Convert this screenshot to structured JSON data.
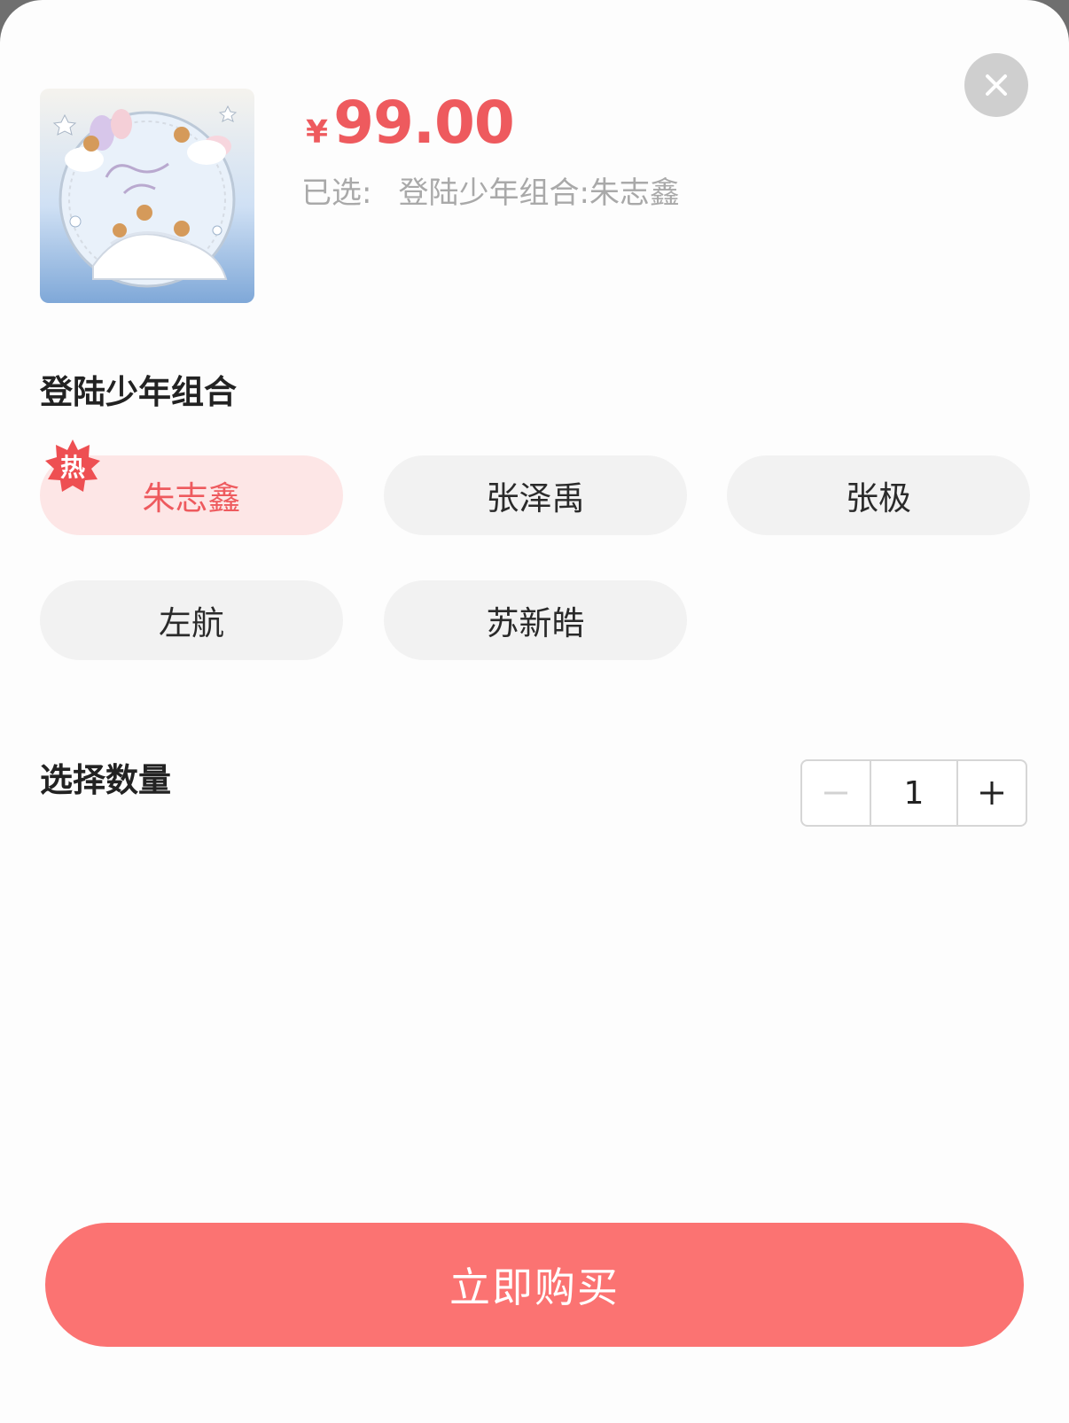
{
  "product": {
    "price_symbol": "¥",
    "price_amount": "99.00",
    "selected_prefix": "已选:",
    "selected_value": "登陆少年组合:朱志鑫"
  },
  "variant_section": {
    "title": "登陆少年组合",
    "hot_label": "热",
    "options": [
      {
        "label": "朱志鑫",
        "selected": true
      },
      {
        "label": "张泽禹",
        "selected": false
      },
      {
        "label": "张极",
        "selected": false
      },
      {
        "label": "左航",
        "selected": false
      },
      {
        "label": "苏新皓",
        "selected": false
      }
    ]
  },
  "quantity": {
    "title": "选择数量",
    "value": "1"
  },
  "buy_button": {
    "label": "立即购买"
  },
  "colors": {
    "accent": "#ee5a5e",
    "button": "#fb7372",
    "selected_bg": "#fde6e6"
  },
  "icons": {
    "close": "close-icon",
    "minus": "minus-icon",
    "plus": "plus-icon",
    "hot": "hot-badge-icon"
  }
}
